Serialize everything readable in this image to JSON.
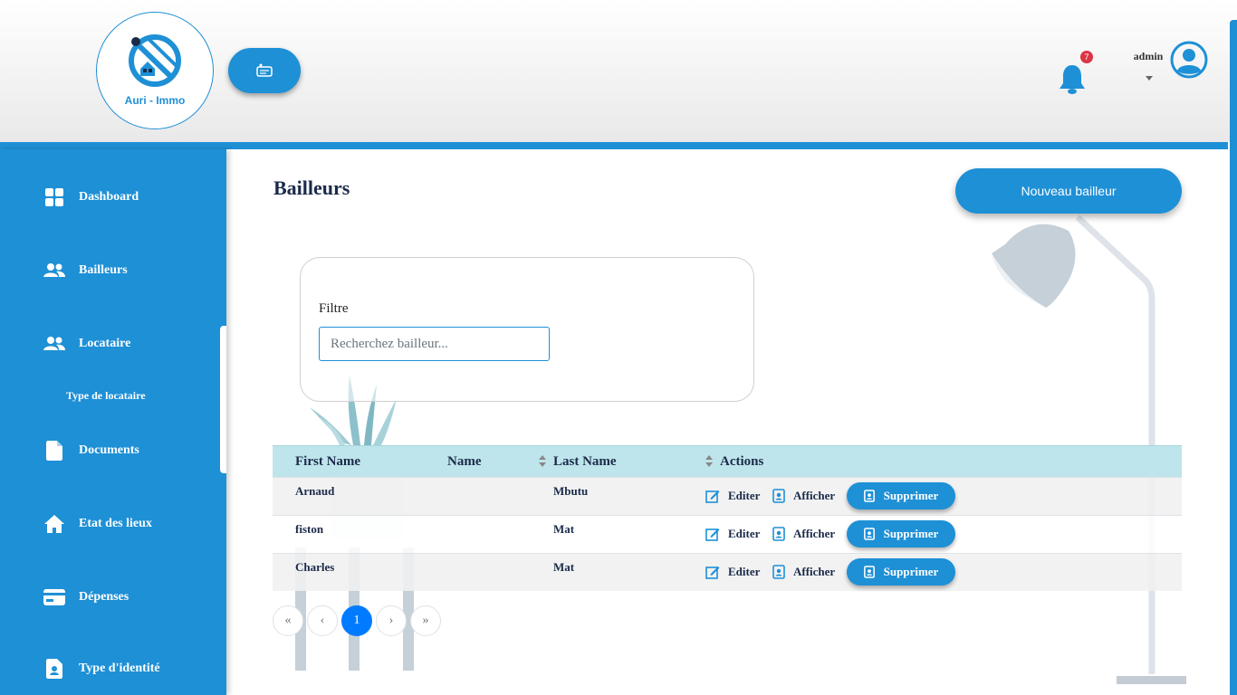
{
  "header": {
    "logo_text": "Auri - Immo",
    "notification_count": "7",
    "user_name": "admin"
  },
  "sidebar": {
    "items": [
      {
        "label": "Dashboard",
        "icon": "grid-icon"
      },
      {
        "label": "Bailleurs",
        "icon": "users-icon"
      },
      {
        "label": "Locataire",
        "icon": "users-icon"
      },
      {
        "label": "Documents",
        "icon": "file-icon"
      },
      {
        "label": "Etat des lieux",
        "icon": "home-icon"
      },
      {
        "label": "Dépenses",
        "icon": "credit-card-icon"
      },
      {
        "label": "Type d'identité",
        "icon": "id-file-icon"
      }
    ],
    "sub_item": "Type de locataire"
  },
  "main": {
    "title": "Bailleurs",
    "new_button": "Nouveau bailleur",
    "filter": {
      "label": "Filtre",
      "placeholder": "Recherchez bailleur..."
    },
    "table": {
      "columns": [
        "First Name",
        "Name",
        "Last Name",
        "Actions"
      ],
      "rows": [
        {
          "first_name": "Arnaud",
          "name": "",
          "last_name": "Mbutu"
        },
        {
          "first_name": "fiston",
          "name": "",
          "last_name": "Mat"
        },
        {
          "first_name": "Charles",
          "name": "",
          "last_name": "Mat"
        }
      ],
      "actions": {
        "edit": "Editer",
        "view": "Afficher",
        "delete": "Supprimer"
      }
    },
    "pagination": {
      "first": "«",
      "prev": "‹",
      "current": "1",
      "next": "›",
      "last": "»"
    }
  },
  "colors": {
    "primary": "#1e90d6",
    "table_header": "#bee5eb",
    "badge": "#dc3545",
    "active_page": "#007bff"
  }
}
